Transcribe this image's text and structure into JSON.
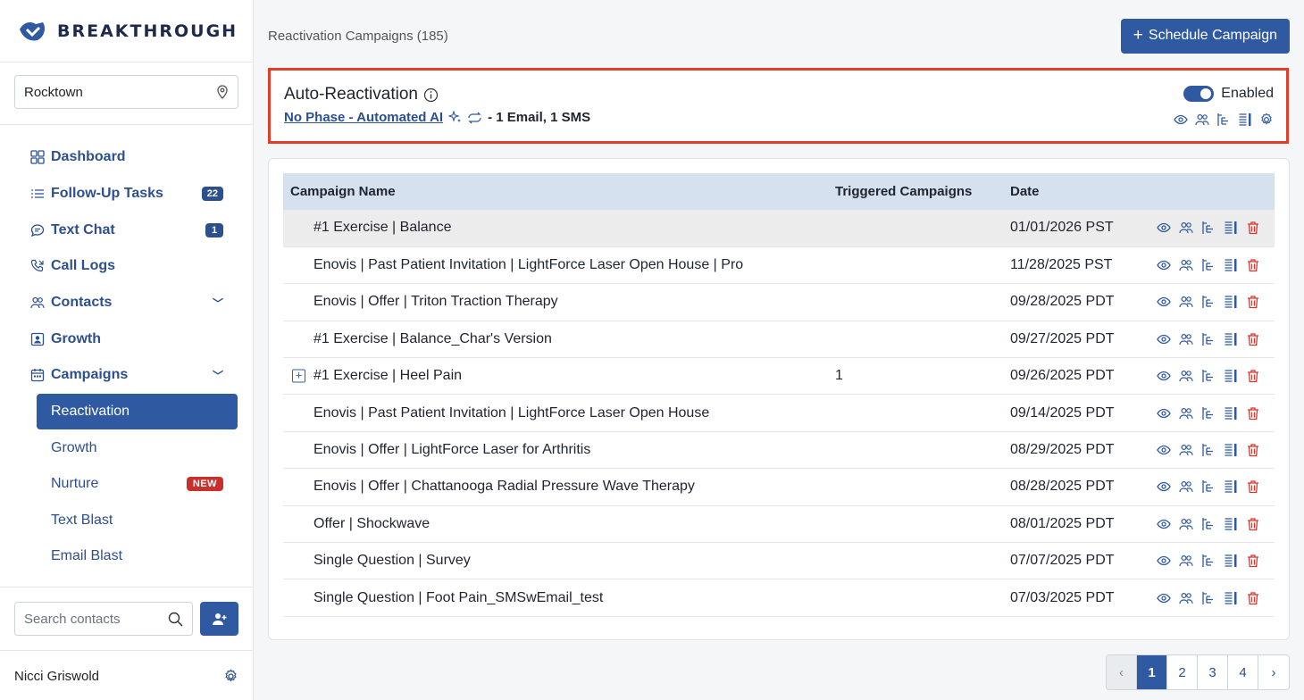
{
  "brand": {
    "name": "BREAKTHROUGH"
  },
  "location": {
    "value": "Rocktown"
  },
  "nav": {
    "items": [
      {
        "label": "Dashboard",
        "icon": "dashboard-icon"
      },
      {
        "label": "Follow-Up Tasks",
        "icon": "list-icon",
        "badge": "22"
      },
      {
        "label": "Text Chat",
        "icon": "chat-icon",
        "badge": "1"
      },
      {
        "label": "Call Logs",
        "icon": "phone-icon"
      },
      {
        "label": "Contacts",
        "icon": "users-icon"
      },
      {
        "label": "Growth",
        "icon": "growth-icon"
      },
      {
        "label": "Campaigns",
        "icon": "calendar-icon"
      }
    ],
    "sub_items": [
      {
        "label": "Reactivation"
      },
      {
        "label": "Growth"
      },
      {
        "label": "Nurture",
        "badge": "NEW"
      },
      {
        "label": "Text Blast"
      },
      {
        "label": "Email Blast"
      }
    ]
  },
  "search": {
    "placeholder": "Search contacts"
  },
  "user": {
    "name": "Nicci Griswold"
  },
  "header": {
    "title": "Reactivation Campaigns (185)",
    "schedule_label": "Schedule Campaign"
  },
  "auto": {
    "title": "Auto-Reactivation",
    "link": "No Phase - Automated AI",
    "detail": "- 1 Email, 1 SMS",
    "toggle_label": "Enabled",
    "enabled": true
  },
  "table": {
    "columns": [
      "Campaign Name",
      "Triggered Campaigns",
      "Date"
    ],
    "rows": [
      {
        "name": "#1 Exercise | Balance",
        "triggered": "",
        "date": "01/01/2026 PST"
      },
      {
        "name": "Enovis | Past Patient Invitation | LightForce Laser Open House | Pro",
        "triggered": "",
        "date": "11/28/2025 PST"
      },
      {
        "name": "Enovis | Offer | Triton Traction Therapy",
        "triggered": "",
        "date": "09/28/2025 PDT"
      },
      {
        "name": "#1 Exercise | Balance_Char's Version",
        "triggered": "",
        "date": "09/27/2025 PDT"
      },
      {
        "name": "#1 Exercise | Heel Pain",
        "triggered": "1",
        "date": "09/26/2025 PDT"
      },
      {
        "name": "Enovis | Past Patient Invitation | LightForce Laser Open House",
        "triggered": "",
        "date": "09/14/2025 PDT"
      },
      {
        "name": "Enovis | Offer | LightForce Laser for Arthritis",
        "triggered": "",
        "date": "08/29/2025 PDT"
      },
      {
        "name": "Enovis | Offer | Chattanooga Radial Pressure Wave Therapy",
        "triggered": "",
        "date": "08/28/2025 PDT"
      },
      {
        "name": "Offer | Shockwave",
        "triggered": "",
        "date": "08/01/2025 PDT"
      },
      {
        "name": "Single Question | Survey",
        "triggered": "",
        "date": "07/07/2025 PDT"
      },
      {
        "name": "Single Question | Foot Pain_SMSwEmail_test",
        "triggered": "",
        "date": "07/03/2025 PDT"
      }
    ]
  },
  "pagination": {
    "prev": "‹",
    "next": "›",
    "pages": [
      "1",
      "2",
      "3",
      "4"
    ],
    "current": "1"
  },
  "colors": {
    "primary": "#2f5aa1",
    "nav_text": "#2d4f8f",
    "highlight_border": "#e23c2b",
    "delete": "#d9342b"
  }
}
